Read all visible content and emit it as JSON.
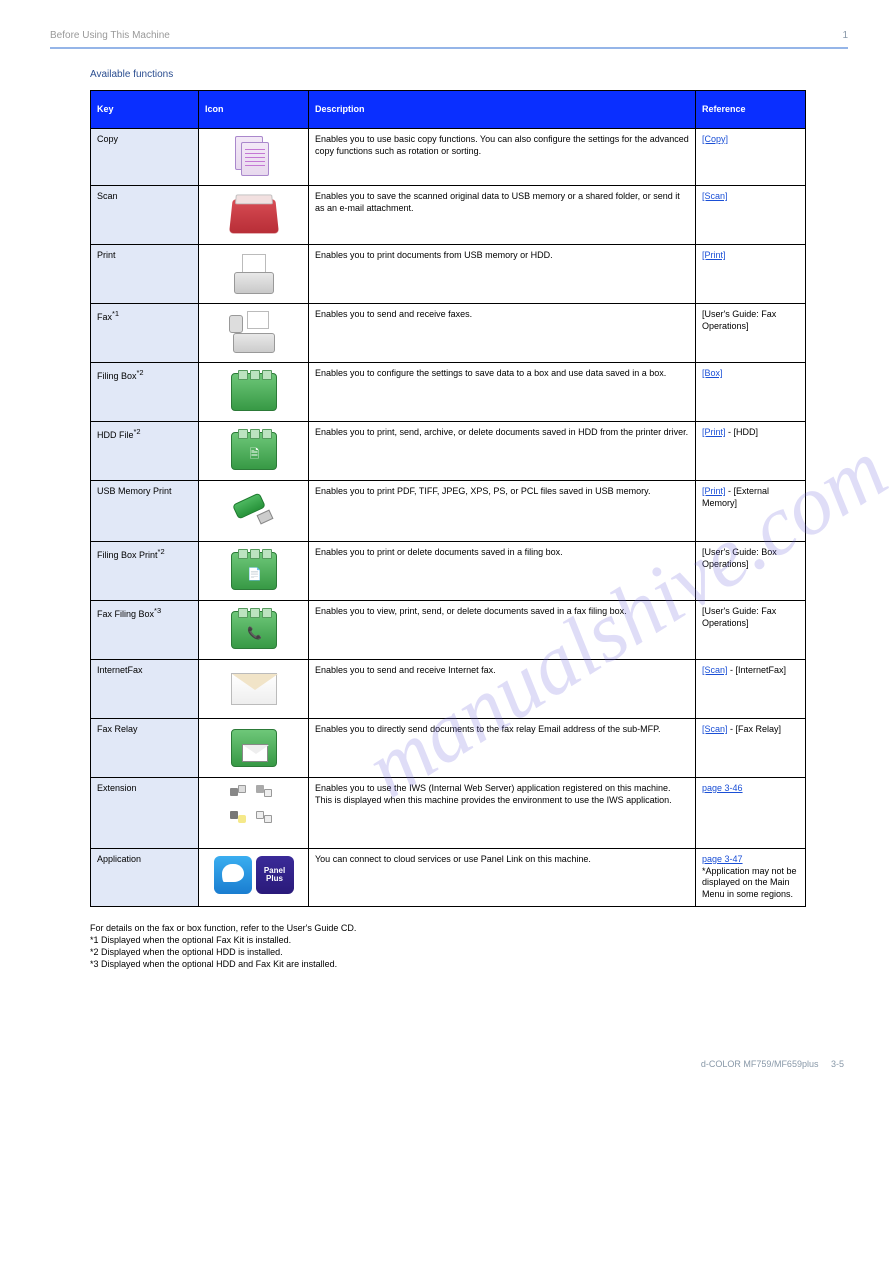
{
  "header": {
    "left": "Before Using This Machine",
    "right": "1"
  },
  "section_title": "Available functions",
  "columns": {
    "c1": "Key",
    "c2": "Icon",
    "c3": "Description",
    "c4": "Reference"
  },
  "rows": [
    {
      "key": "Copy",
      "icon": "copy-icon",
      "desc": "Enables you to use basic copy functions. You can also configure the settings for the advanced copy functions such as rotation or sorting.",
      "link": "[Copy]",
      "ref_rest": ""
    },
    {
      "key": "Scan",
      "icon": "scan-icon",
      "desc": "Enables you to save the scanned original data to USB memory or a shared folder, or send it as an e-mail attachment.",
      "link": "[Scan]",
      "ref_rest": ""
    },
    {
      "key": "Print",
      "icon": "print-icon",
      "desc": "Enables you to print documents from USB memory or HDD.",
      "link": "[Print]",
      "ref_rest": ""
    },
    {
      "key": "Fax",
      "icon": "fax-icon",
      "desc": "Enables you to send and receive faxes.",
      "link": "",
      "ref_rest": "[User's Guide: Fax Operations]"
    },
    {
      "key": "Filing Box",
      "icon": "filingbox-icon",
      "desc": "Enables you to configure the settings to save data to a box and use data saved in a box.",
      "link": "[Box]",
      "ref_rest": ""
    },
    {
      "key": "HDD File",
      "icon": "hddfile-icon",
      "desc": "Enables you to print, send, archive, or delete documents saved in HDD from the printer driver.",
      "link": "[Print]",
      "ref_rest": " - [HDD]"
    },
    {
      "key": "USB Memory Print",
      "icon": "usb-icon",
      "desc": "Enables you to print PDF, TIFF, JPEG, XPS, PS, or PCL files saved in USB memory.",
      "link": "[Print]",
      "ref_rest": " - [External Memory]"
    },
    {
      "key": "Filing Box Print",
      "icon": "filingprint-icon",
      "desc": "Enables you to print or delete documents saved in a filing box.",
      "link": "",
      "ref_rest": "[User's Guide: Box Operations]"
    },
    {
      "key": "Fax Filing Box",
      "icon": "faxbox-icon",
      "desc": "Enables you to view, print, send, or delete documents saved in a fax filing box.",
      "link": "",
      "ref_rest": "[User's Guide: Fax Operations]"
    },
    {
      "key": "InternetFax",
      "icon": "ifax-icon",
      "desc": "Enables you to send and receive Internet fax.",
      "link": "[Scan]",
      "ref_rest": " - [InternetFax]"
    },
    {
      "key": "Fax Relay",
      "icon": "relay-icon",
      "desc": "Enables you to directly send documents to the fax relay Email address of the sub-MFP.",
      "link": "[Scan]",
      "ref_rest": " - [Fax Relay]"
    },
    {
      "key": "Extension",
      "icon": "extension-icon",
      "desc": "Enables you to use the IWS (Internal Web Server) application registered on this machine. This is displayed when this machine provides the environment to use the IWS application.",
      "link": "page 3-46",
      "ref_rest": ""
    },
    {
      "key": "Application",
      "icon": "application-icon",
      "desc": "You can connect to cloud services or use Panel Link on this machine.",
      "link": "page 3-47",
      "ref_rest": "\n*Application may not be displayed on the Main Menu in some regions."
    }
  ],
  "notes": {
    "n1": "For details on the fax or box function, refer to the User's Guide CD.",
    "n2": "*1     Displayed when the optional Fax Kit is installed.",
    "n3": "*2     Displayed when the optional HDD is installed.",
    "n4": "*3     Displayed when the optional HDD and Fax Kit are installed."
  },
  "footer": {
    "model": "d-COLOR MF759/MF659plus",
    "page": "3-5"
  },
  "watermark": "manualshive.com",
  "appLabel": "Panel\nPlus"
}
